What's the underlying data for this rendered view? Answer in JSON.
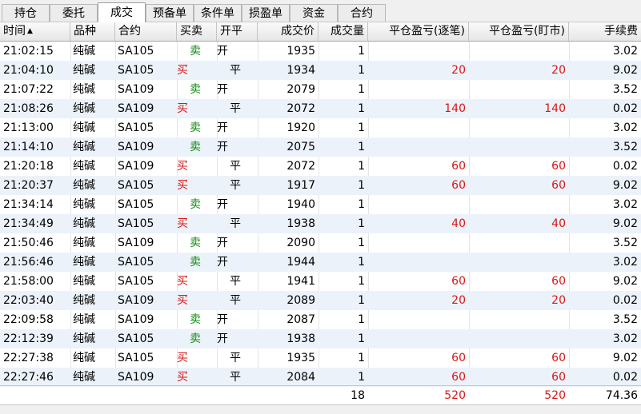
{
  "tabs": [
    "持仓",
    "委托",
    "成交",
    "预备单",
    "条件单",
    "损盈单",
    "资金",
    "合约"
  ],
  "active_tab": "成交",
  "columns": {
    "time": "时间",
    "product": "品种",
    "contract": "合约",
    "direction": "买卖",
    "offset": "开平",
    "price": "成交价",
    "volume": "成交量",
    "pnl_trade": "平仓盈亏(逐笔)",
    "pnl_mtm": "平仓盈亏(盯市)",
    "fee": "手续费"
  },
  "sort_indicator": "▲",
  "rows": [
    {
      "time": "21:02:15",
      "product": "纯碱",
      "contract": "SA105",
      "dir": "卖",
      "offset": "开",
      "price": "1935",
      "volume": "1",
      "pnl_trade": "",
      "pnl_mtm": "",
      "fee": "3.02"
    },
    {
      "time": "21:04:10",
      "product": "纯碱",
      "contract": "SA105",
      "dir": "买",
      "offset": "平",
      "price": "1934",
      "volume": "1",
      "pnl_trade": "20",
      "pnl_mtm": "20",
      "fee": "9.02"
    },
    {
      "time": "21:07:22",
      "product": "纯碱",
      "contract": "SA109",
      "dir": "卖",
      "offset": "开",
      "price": "2079",
      "volume": "1",
      "pnl_trade": "",
      "pnl_mtm": "",
      "fee": "3.52"
    },
    {
      "time": "21:08:26",
      "product": "纯碱",
      "contract": "SA109",
      "dir": "买",
      "offset": "平",
      "price": "2072",
      "volume": "1",
      "pnl_trade": "140",
      "pnl_mtm": "140",
      "fee": "0.02"
    },
    {
      "time": "21:13:00",
      "product": "纯碱",
      "contract": "SA105",
      "dir": "卖",
      "offset": "开",
      "price": "1920",
      "volume": "1",
      "pnl_trade": "",
      "pnl_mtm": "",
      "fee": "3.02"
    },
    {
      "time": "21:14:10",
      "product": "纯碱",
      "contract": "SA109",
      "dir": "卖",
      "offset": "开",
      "price": "2075",
      "volume": "1",
      "pnl_trade": "",
      "pnl_mtm": "",
      "fee": "3.52"
    },
    {
      "time": "21:20:18",
      "product": "纯碱",
      "contract": "SA109",
      "dir": "买",
      "offset": "平",
      "price": "2072",
      "volume": "1",
      "pnl_trade": "60",
      "pnl_mtm": "60",
      "fee": "0.02"
    },
    {
      "time": "21:20:37",
      "product": "纯碱",
      "contract": "SA105",
      "dir": "买",
      "offset": "平",
      "price": "1917",
      "volume": "1",
      "pnl_trade": "60",
      "pnl_mtm": "60",
      "fee": "9.02"
    },
    {
      "time": "21:34:14",
      "product": "纯碱",
      "contract": "SA105",
      "dir": "卖",
      "offset": "开",
      "price": "1940",
      "volume": "1",
      "pnl_trade": "",
      "pnl_mtm": "",
      "fee": "3.02"
    },
    {
      "time": "21:34:49",
      "product": "纯碱",
      "contract": "SA105",
      "dir": "买",
      "offset": "平",
      "price": "1938",
      "volume": "1",
      "pnl_trade": "40",
      "pnl_mtm": "40",
      "fee": "9.02"
    },
    {
      "time": "21:50:46",
      "product": "纯碱",
      "contract": "SA109",
      "dir": "卖",
      "offset": "开",
      "price": "2090",
      "volume": "1",
      "pnl_trade": "",
      "pnl_mtm": "",
      "fee": "3.52"
    },
    {
      "time": "21:56:46",
      "product": "纯碱",
      "contract": "SA105",
      "dir": "卖",
      "offset": "开",
      "price": "1944",
      "volume": "1",
      "pnl_trade": "",
      "pnl_mtm": "",
      "fee": "3.02"
    },
    {
      "time": "21:58:00",
      "product": "纯碱",
      "contract": "SA105",
      "dir": "买",
      "offset": "平",
      "price": "1941",
      "volume": "1",
      "pnl_trade": "60",
      "pnl_mtm": "60",
      "fee": "9.02"
    },
    {
      "time": "22:03:40",
      "product": "纯碱",
      "contract": "SA109",
      "dir": "买",
      "offset": "平",
      "price": "2089",
      "volume": "1",
      "pnl_trade": "20",
      "pnl_mtm": "20",
      "fee": "0.02"
    },
    {
      "time": "22:09:58",
      "product": "纯碱",
      "contract": "SA109",
      "dir": "卖",
      "offset": "开",
      "price": "2087",
      "volume": "1",
      "pnl_trade": "",
      "pnl_mtm": "",
      "fee": "3.52"
    },
    {
      "time": "22:12:39",
      "product": "纯碱",
      "contract": "SA105",
      "dir": "卖",
      "offset": "开",
      "price": "1938",
      "volume": "1",
      "pnl_trade": "",
      "pnl_mtm": "",
      "fee": "3.02"
    },
    {
      "time": "22:27:38",
      "product": "纯碱",
      "contract": "SA105",
      "dir": "买",
      "offset": "平",
      "price": "1935",
      "volume": "1",
      "pnl_trade": "60",
      "pnl_mtm": "60",
      "fee": "9.02"
    },
    {
      "time": "22:27:46",
      "product": "纯碱",
      "contract": "SA109",
      "dir": "买",
      "offset": "平",
      "price": "2084",
      "volume": "1",
      "pnl_trade": "60",
      "pnl_mtm": "60",
      "fee": "0.02"
    }
  ],
  "totals": {
    "volume": "18",
    "pnl_trade": "520",
    "pnl_mtm": "520",
    "fee": "74.36"
  },
  "colors": {
    "buy": "#d81818",
    "sell": "#138a13",
    "profit": "#d81818",
    "row_alt": "#ecf2f9"
  }
}
